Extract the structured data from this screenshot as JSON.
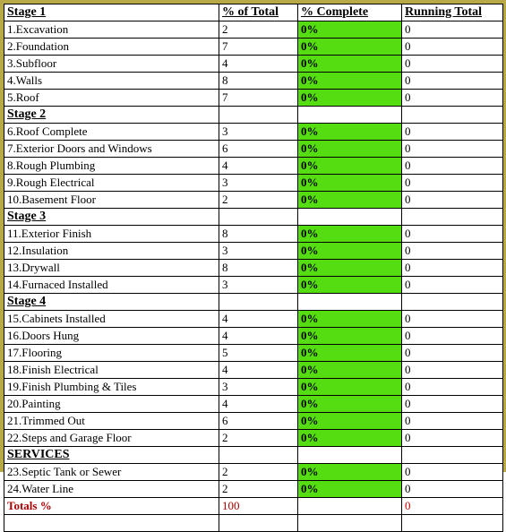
{
  "headers": {
    "stage": "Stage 1",
    "pct_total": "% of Total",
    "pct_complete": "% Complete",
    "running_total": "Running Total"
  },
  "sections": [
    {
      "title": null,
      "rows": [
        {
          "label": "1.Excavation",
          "pct_total": "2",
          "pct_complete": "0%",
          "running": "0"
        },
        {
          "label": "2.Foundation",
          "pct_total": "7",
          "pct_complete": "0%",
          "running": "0"
        },
        {
          "label": "3.Subfloor",
          "pct_total": "4",
          "pct_complete": "0%",
          "running": "0"
        },
        {
          "label": "4.Walls",
          "pct_total": "8",
          "pct_complete": "0%",
          "running": "0"
        },
        {
          "label": "5.Roof",
          "pct_total": "7",
          "pct_complete": "0%",
          "running": "0"
        }
      ]
    },
    {
      "title": "Stage 2",
      "rows": [
        {
          "label": "6.Roof Complete",
          "pct_total": "3",
          "pct_complete": "0%",
          "running": "0"
        },
        {
          "label": "7.Exterior Doors and Windows",
          "pct_total": "6",
          "pct_complete": "0%",
          "running": "0"
        },
        {
          "label": "8.Rough Plumbing",
          "pct_total": "4",
          "pct_complete": "0%",
          "running": "0"
        },
        {
          "label": "9.Rough Electrical",
          "pct_total": "3",
          "pct_complete": "0%",
          "running": "0"
        },
        {
          "label": "10.Basement Floor",
          "pct_total": "2",
          "pct_complete": "0%",
          "running": "0"
        }
      ]
    },
    {
      "title": "Stage 3",
      "rows": [
        {
          "label": "11.Exterior Finish",
          "pct_total": "8",
          "pct_complete": "0%",
          "running": "0"
        },
        {
          "label": "12.Insulation",
          "pct_total": "3",
          "pct_complete": "0%",
          "running": "0"
        },
        {
          "label": "13.Drywall",
          "pct_total": "8",
          "pct_complete": "0%",
          "running": "0"
        },
        {
          "label": "14.Furnaced Installed",
          "pct_total": "3",
          "pct_complete": "0%",
          "running": "0"
        }
      ]
    },
    {
      "title": "Stage 4",
      "rows": [
        {
          "label": "15.Cabinets Installed",
          "pct_total": "4",
          "pct_complete": "0%",
          "running": "0"
        },
        {
          "label": "16.Doors Hung",
          "pct_total": "4",
          "pct_complete": "0%",
          "running": "0"
        },
        {
          "label": "17.Flooring",
          "pct_total": "5",
          "pct_complete": "0%",
          "running": "0"
        },
        {
          "label": "18.Finish Electrical",
          "pct_total": "4",
          "pct_complete": "0%",
          "running": "0"
        },
        {
          "label": "19.Finish Plumbing & Tiles",
          "pct_total": "3",
          "pct_complete": "0%",
          "running": "0"
        },
        {
          "label": "20.Painting",
          "pct_total": "4",
          "pct_complete": "0%",
          "running": "0"
        },
        {
          "label": "21.Trimmed Out",
          "pct_total": "6",
          "pct_complete": "0%",
          "running": "0"
        },
        {
          "label": "22.Steps and Garage Floor",
          "pct_total": "2",
          "pct_complete": "0%",
          "running": "0"
        }
      ]
    },
    {
      "title": "SERVICES",
      "rows": [
        {
          "label": "23.Septic Tank or Sewer",
          "pct_total": "2",
          "pct_complete": "0%",
          "running": "0"
        },
        {
          "label": "24.Water Line",
          "pct_total": "2",
          "pct_complete": "0%",
          "running": "0"
        }
      ]
    }
  ],
  "totals": {
    "label": "Totals %",
    "pct_total": "100",
    "pct_complete": "",
    "running": "0"
  }
}
